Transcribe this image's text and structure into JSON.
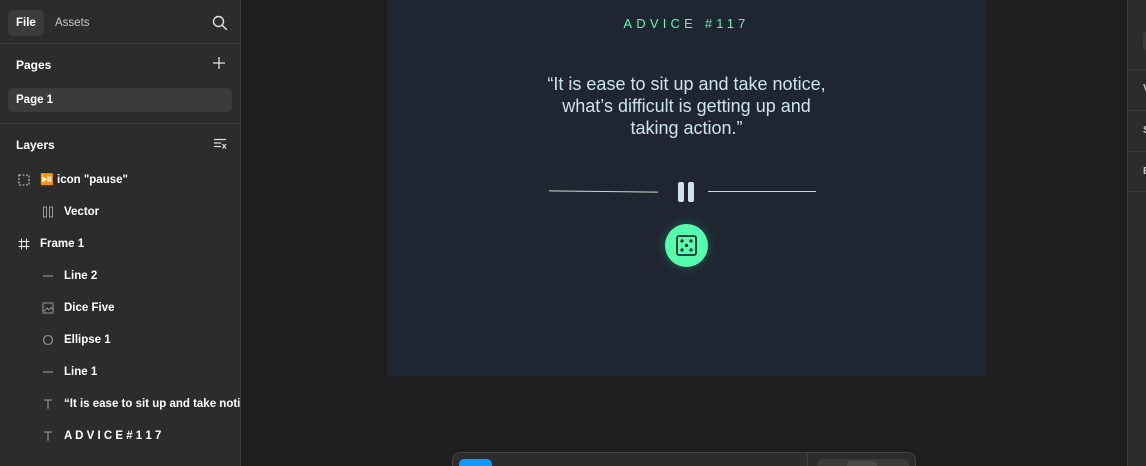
{
  "left_panel": {
    "tabs": {
      "file": "File",
      "assets": "Assets"
    },
    "pages": {
      "title": "Pages",
      "items": [
        "Page 1"
      ]
    },
    "layers": {
      "title": "Layers",
      "items": [
        {
          "name": "icon \"pause\"",
          "icon": "selection-dashed-icon",
          "emoji": "⏯️"
        },
        {
          "name": "Vector",
          "icon": "vector-pause-icon"
        },
        {
          "name": "Frame 1",
          "icon": "frame-hash-icon"
        },
        {
          "name": "Line 2",
          "icon": "line-icon"
        },
        {
          "name": "Dice Five",
          "icon": "image-icon"
        },
        {
          "name": "Ellipse 1",
          "icon": "ellipse-icon"
        },
        {
          "name": "Line 1",
          "icon": "line-icon"
        },
        {
          "name": "“It is ease to sit up and take notice, what’s difficult is getting up and taking action.”",
          "icon": "text-icon"
        },
        {
          "name": "A D V I C E # 1 1 7",
          "icon": "text-icon"
        }
      ]
    }
  },
  "canvas": {
    "advice_heading": "ADVICE #117",
    "quote": "“It is ease to sit up and take notice, what’s difficult is getting up and taking action.”",
    "colors": {
      "background": "#1f2632",
      "accent": "#53ffaa",
      "text": "#cee3e9"
    }
  },
  "right_panel": {
    "labels": [
      "V",
      "S",
      "E"
    ]
  },
  "colors": {
    "ui_background": "#1e1e1e",
    "panel": "#2c2c2c",
    "selection": "#3b3b3b",
    "tool_active": "#0d99ff"
  }
}
